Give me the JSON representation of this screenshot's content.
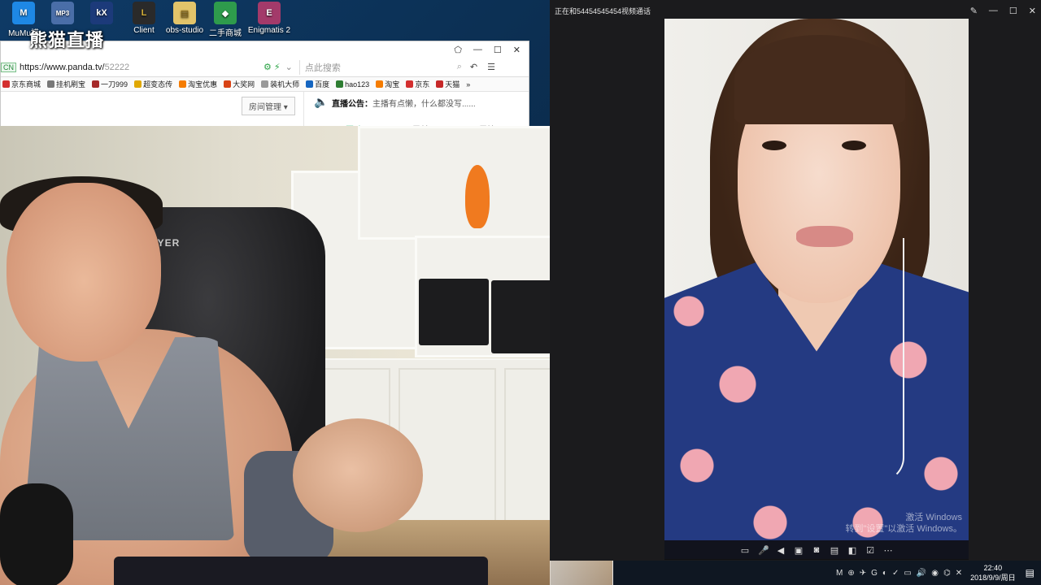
{
  "desktop": {
    "icons": [
      {
        "label": "MuMu模",
        "glyph": "M",
        "color": "#1e88e5"
      },
      {
        "label": "",
        "glyph": "MP3",
        "color": "#4a6ea8"
      },
      {
        "label": "",
        "glyph": "kX",
        "color": "#1c3a7a"
      },
      {
        "label": "Client",
        "glyph": "L",
        "color": "#2a2a2a"
      },
      {
        "label": "obs-studio",
        "glyph": "▤",
        "color": "#e2c46a"
      },
      {
        "label": "二手商城",
        "glyph": "◆",
        "color": "#2e9b4c"
      },
      {
        "label": "Enigmatis 2",
        "glyph": "E",
        "color": "#a33a6a"
      }
    ],
    "watermark": "熊猫直播"
  },
  "browser": {
    "cn_badge": "CN",
    "url_prefix": "https://www.panda.tv/",
    "url_path": "52222",
    "search_placeholder": "点此搜索",
    "bookmarks": [
      {
        "label": "京东商城",
        "color": "#d32f2f"
      },
      {
        "label": "挂机刷宝",
        "color": "#777"
      },
      {
        "label": "一刀999",
        "color": "#a52a2a"
      },
      {
        "label": "超变态传",
        "color": "#e0a800"
      },
      {
        "label": "淘宝优惠",
        "color": "#f57c00"
      },
      {
        "label": "大奖网",
        "color": "#d84315"
      },
      {
        "label": "装机大师",
        "color": "#999"
      },
      {
        "label": "百度",
        "color": "#1565c0"
      },
      {
        "label": "hao123",
        "color": "#2e7d32"
      },
      {
        "label": "淘宝",
        "color": "#f57c00"
      },
      {
        "label": "京东",
        "color": "#d32f2f"
      },
      {
        "label": "天猫",
        "color": "#c62828"
      }
    ],
    "room_button": "房间管理 ▾",
    "announcement_label": "直播公告：",
    "announcement_text": "主播有点懒，什么都没写......",
    "tabs": [
      "互动",
      "贡献",
      "周榜"
    ]
  },
  "webcam": {
    "chair_brand": "AYER"
  },
  "video_call": {
    "title": "正在和54454545454视频通话",
    "watermark_line1": "激活 Windows",
    "watermark_line2": "转到\"设置\"以激活 Windows。",
    "toolbar_icons": [
      "chat-icon",
      "mic-icon",
      "speaker-icon",
      "camera-icon",
      "screenshot-icon",
      "record-icon",
      "layout-icon",
      "edit-icon",
      "more-icon"
    ]
  },
  "taskbar": {
    "time": "22:40",
    "date": "2018/9/9/周日",
    "tray_icons": [
      "M",
      "⊕",
      "✈",
      "G",
      "◐",
      "✓",
      "◉",
      "⌬",
      "✕"
    ]
  }
}
